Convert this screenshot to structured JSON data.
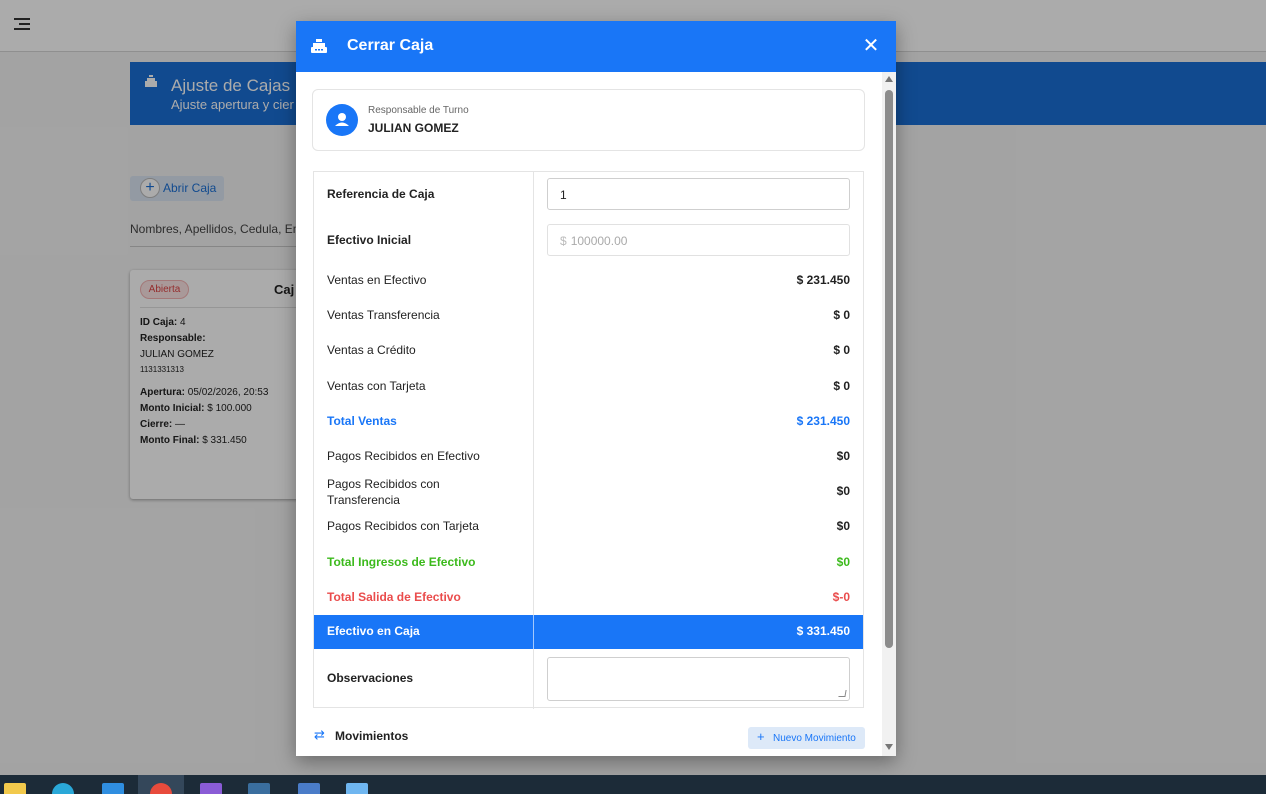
{
  "background": {
    "banner": {
      "title": "Ajuste de Cajas",
      "subtitle": "Ajuste apertura y cier"
    },
    "open_button_label": "Abrir Caja",
    "search_hint": "Nombres, Apellidos, Cedula, Em",
    "card": {
      "status": "Abierta",
      "title": "Caj",
      "id_label": "ID Caja:",
      "id_value": "4",
      "responsable_label": "Responsable:",
      "responsable_name": "JULIAN GOMEZ",
      "responsable_id": "1131331313",
      "apertura_label": "Apertura:",
      "apertura_value": "05/02/2026, 20:53",
      "monto_inicial_label": "Monto Inicial:",
      "monto_inicial_value": "$ 100.000",
      "cierre_label": "Cierre:",
      "cierre_value": "—",
      "monto_final_label": "Monto Final:",
      "monto_final_value": "$ 331.450"
    }
  },
  "modal": {
    "title": "Cerrar Caja",
    "close_glyph": "✕",
    "responsable": {
      "label": "Responsable de Turno",
      "name": "JULIAN GOMEZ"
    },
    "referencia": {
      "label": "Referencia de Caja",
      "value": "1"
    },
    "efectivo_inicial": {
      "label": "Efectivo Inicial",
      "prefix": "$",
      "placeholder": "100000.00"
    },
    "rows": {
      "ventas_efectivo": {
        "label": "Ventas en Efectivo",
        "value": "$ 231.450"
      },
      "ventas_transferencia": {
        "label": "Ventas Transferencia",
        "value": "$ 0"
      },
      "ventas_credito": {
        "label": "Ventas a Crédito",
        "value": "$ 0"
      },
      "ventas_tarjeta": {
        "label": "Ventas con Tarjeta",
        "value": "$ 0"
      },
      "total_ventas": {
        "label": "Total Ventas",
        "value": "$ 231.450"
      },
      "pagos_efectivo": {
        "label": "Pagos Recibidos en Efectivo",
        "value": "$0"
      },
      "pagos_transferencia": {
        "label": "Pagos Recibidos con Transferencia",
        "value": "$0"
      },
      "pagos_tarjeta": {
        "label": "Pagos Recibidos con Tarjeta",
        "value": "$0"
      },
      "total_ingresos": {
        "label": "Total Ingresos de Efectivo",
        "value": "$0"
      },
      "total_salida": {
        "label": "Total Salida de Efectivo",
        "value": "$-0"
      },
      "efectivo_caja": {
        "label": "Efectivo en Caja",
        "value": "$ 331.450"
      }
    },
    "observaciones_label": "Observaciones",
    "movimientos_label": "Movimientos",
    "nuevo_movimiento_label": "Nuevo Movimiento"
  },
  "colors": {
    "primary": "#1976f7",
    "success": "#3cba1c",
    "danger": "#ea4c4c",
    "taskbar": "#1c2b38"
  },
  "taskbar": {
    "icons": [
      "file-explorer-icon",
      "edge-icon",
      "vscode-icon",
      "chrome-icon",
      "app-icon",
      "mysql-workbench-icon",
      "app-icon-2",
      "app-icon-3"
    ]
  }
}
